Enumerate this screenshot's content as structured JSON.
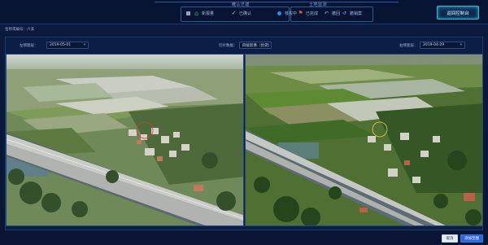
{
  "topbar": {
    "group_left_title": "確认迁建",
    "group_right_title": "土地监测",
    "items": [
      {
        "label": "新报量",
        "icon": "house-icon"
      },
      {
        "label": "已确认",
        "icon": "check-icon"
      },
      {
        "label": "核实中",
        "icon": "dot-icon"
      },
      {
        "label": "已完成",
        "icon": "flag-icon"
      },
      {
        "label": "撤回",
        "icon": "undo-icon"
      },
      {
        "label": "撤销案",
        "icon": "uturn-icon"
      }
    ],
    "back_label": "返回控制台"
  },
  "info": {
    "text": "名称或编号：六溪"
  },
  "controls": {
    "left_date_label": "左侧图层：",
    "left_date_value": "2019-05-01",
    "center_label": "切片数据：",
    "center_value": "四级影像（优先）",
    "right_date_label": "右侧图层：",
    "right_date_value": "2019-04-29"
  },
  "footer": {
    "cancel_label": "取消",
    "save_label": "添加至图"
  },
  "colors": {
    "accent": "#37b6c9",
    "primary_button": "#2d66d6",
    "background": "#0a1838"
  }
}
